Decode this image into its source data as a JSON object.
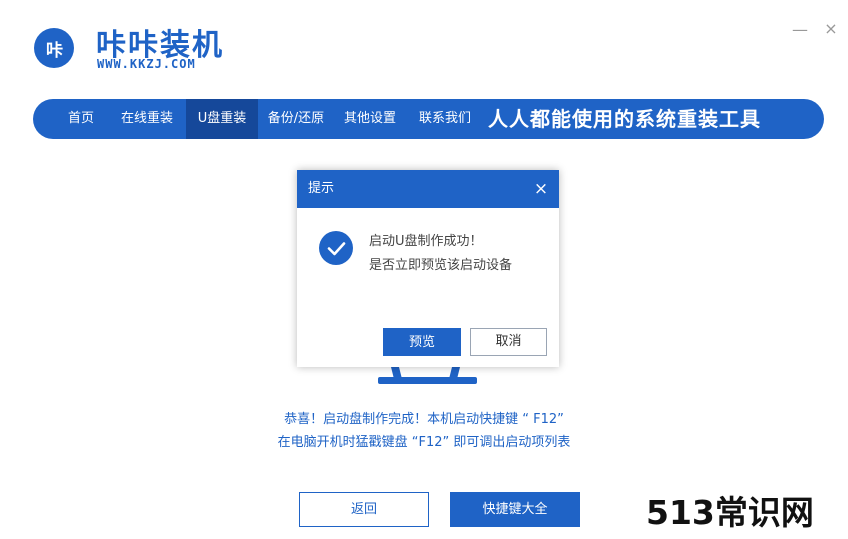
{
  "header": {
    "logo_text": "咔",
    "brand_name": "咔咔装机",
    "brand_url": "WWW.KKZJ.COM",
    "minimize_glyph": "—",
    "close_glyph": "×"
  },
  "nav": {
    "items": [
      {
        "label": "首页",
        "active": false
      },
      {
        "label": "在线重装",
        "active": false
      },
      {
        "label": "U盘重装",
        "active": true
      },
      {
        "label": "备份/还原",
        "active": false
      },
      {
        "label": "其他设置",
        "active": false
      },
      {
        "label": "联系我们",
        "active": false
      }
    ],
    "slogan": "人人都能使用的系统重装工具"
  },
  "dialog": {
    "title": "提示",
    "close_glyph": "×",
    "message_line1": "启动U盘制作成功！",
    "message_line2": "是否立即预览该启动设备",
    "confirm_label": "预览",
    "cancel_label": "取消",
    "icon": "check-circle-icon"
  },
  "info": {
    "line1": "恭喜！启动盘制作完成！本机启动快捷键 “ F12”",
    "line2": "在电脑开机时猛戳键盘 “F12” 即可调出启动项列表"
  },
  "footer": {
    "back_label": "返回",
    "shortcuts_label": "快捷键大全"
  },
  "watermark": "513常识网",
  "colors": {
    "primary": "#1f63c6",
    "nav_active": "#15489a"
  }
}
